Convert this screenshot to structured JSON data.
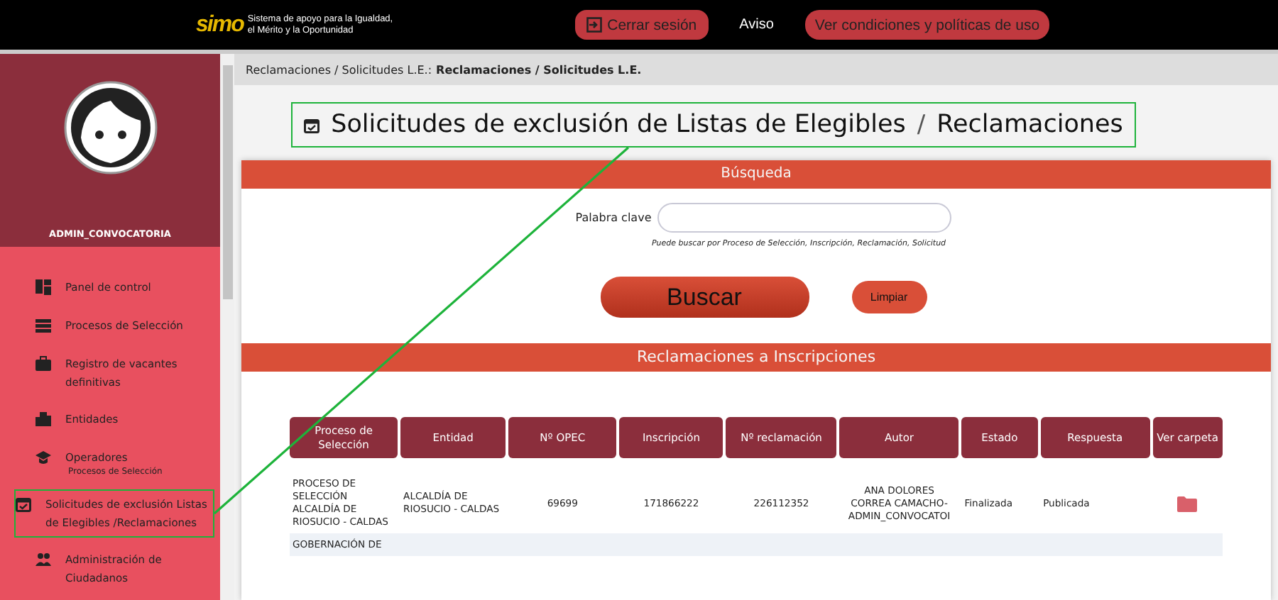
{
  "top_bar": {
    "logo": "simo",
    "tagline": [
      "Sistema de apoyo para la Igualdad,",
      "el Mérito y la Oportunidad"
    ],
    "logout_button": "Cerrar sesión",
    "notice_link": "Aviso",
    "terms_button": "Ver condiciones y políticas de uso"
  },
  "sidebar": {
    "user": "ADMIN_CONVOCATORIA",
    "items": [
      {
        "label": "Panel de control",
        "highlighted": false
      },
      {
        "label": "Procesos de Selección",
        "highlighted": false
      },
      {
        "label": "Registro de vacantes definitivas",
        "highlighted": false
      },
      {
        "label": "Entidades",
        "highlighted": false
      },
      {
        "label": "Operadores",
        "sublabel": "Procesos de Selección",
        "highlighted": false
      },
      {
        "label": "Solicitudes de exclusión Listas de Elegibles /Reclamaciones",
        "highlighted": true
      },
      {
        "label": "Administración de Ciudadanos",
        "highlighted": false
      }
    ]
  },
  "breadcrumb": {
    "path": "Reclamaciones / Solicitudes L.E.:",
    "current": "Reclamaciones / Solicitudes L.E."
  },
  "page_title": {
    "text": "Solicitudes de exclusión de Listas de Elegibles",
    "separator": "/",
    "suffix": "Reclamaciones",
    "highlighted": true
  },
  "search": {
    "header": "Búsqueda",
    "label": "Palabra clave",
    "hint": "Puede buscar por Proceso de Selección, Inscripción, Reclamación, Solicitud",
    "search_button": "Buscar",
    "clear_button": "Limpiar"
  },
  "table": {
    "header": "Reclamaciones a Inscripciones",
    "columns": [
      "Proceso de Selección",
      "Entidad",
      "Nº OPEC",
      "Inscripción",
      "Nº reclamación",
      "Autor",
      "Estado",
      "Respuesta",
      "Ver carpeta"
    ],
    "rows": [
      {
        "cells": [
          "PROCESO DE SELECCIÓN ALCALDÍA DE RIOSUCIO - CALDAS",
          "ALCALDÍA DE RIOSUCIO - CALDAS",
          "69699",
          "171866222",
          "226112352",
          "ANA DOLORES CORREA CAMACHO-ADMIN_CONVOCATOI",
          "Finalizada",
          "Publicada"
        ],
        "folder": true
      },
      {
        "cells": [
          "GOBERNACIÓN DE"
        ]
      }
    ]
  }
}
